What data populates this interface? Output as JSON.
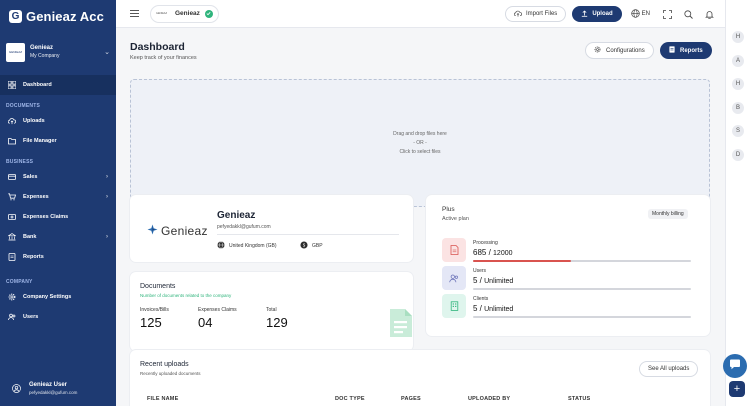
{
  "brand": {
    "name": "Genieaz Acc"
  },
  "sidebar": {
    "company": {
      "name": "Genieaz",
      "subtitle": "My Company",
      "logo_text": "GENIEAZ"
    },
    "dashboard_label": "Dashboard",
    "sections": {
      "documents": "DOCUMENTS",
      "business": "BUSINESS",
      "company": "COMPANY"
    },
    "items": {
      "uploads": "Uploads",
      "file_manager": "File Manager",
      "sales": "Sales",
      "expenses": "Expenses",
      "expenses_claims": "Expenses Claims",
      "bank": "Bank",
      "reports": "Reports",
      "company_settings": "Company Settings",
      "users": "Users"
    },
    "user": {
      "name": "Genieaz User",
      "email": "pefyedakkl@gufum.com"
    }
  },
  "topbar": {
    "company_chip": {
      "name": "Genieaz",
      "logo_text": "GENIEAZ"
    },
    "import_label": "Import Files",
    "upload_label": "Upload",
    "language": "EN"
  },
  "rail": {
    "avatars": [
      "H",
      "A",
      "H",
      "B",
      "S",
      "D"
    ]
  },
  "dashboard": {
    "title": "Dashboard",
    "subtitle": "Keep track of your finances",
    "configurations_label": "Configurations",
    "reports_label": "Reports",
    "dropzone": {
      "line1": "Drag and drop files here",
      "line2": "- OR -",
      "line3": "Click to select files"
    }
  },
  "company_card": {
    "logo_text": "Genieaz",
    "name": "Genieaz",
    "email": "pefyedakkl@gufum.com",
    "country": "United Kingdom (GB)",
    "currency": "GBP"
  },
  "documents_card": {
    "title": "Documents",
    "subtitle": "Number of documents related to the company",
    "stats": [
      {
        "label": "Invoices/Bills",
        "value": "125"
      },
      {
        "label": "Expenses Claims",
        "value": "04"
      },
      {
        "label": "Total",
        "value": "129"
      }
    ]
  },
  "plan_card": {
    "title": "Plus",
    "subtitle": "Active plan",
    "badge": "Monthly billing",
    "metrics": [
      {
        "label": "Processing",
        "used": "685",
        "limit": "12000",
        "fill": 0.45,
        "color": "#d9534f",
        "tile": "#fbe3e3"
      },
      {
        "label": "Users",
        "used": "5",
        "limit": "Unlimited",
        "fill": 0.0,
        "color": "#8a93a6",
        "tile": "#e4e7f6"
      },
      {
        "label": "Clients",
        "used": "5",
        "limit": "Unlimited",
        "fill": 0.0,
        "color": "#8a93a6",
        "tile": "#dff5ed"
      }
    ]
  },
  "uploads_card": {
    "title": "Recent uploads",
    "subtitle": "Recently uploaded documents",
    "see_all_label": "See All uploads",
    "columns": [
      "FILE NAME",
      "DOC TYPE",
      "PAGES",
      "UPLOADED BY",
      "STATUS"
    ]
  },
  "colors": {
    "brand": "#1e3a72",
    "accent_green": "#2fb47c",
    "processing_red": "#d9534f"
  }
}
